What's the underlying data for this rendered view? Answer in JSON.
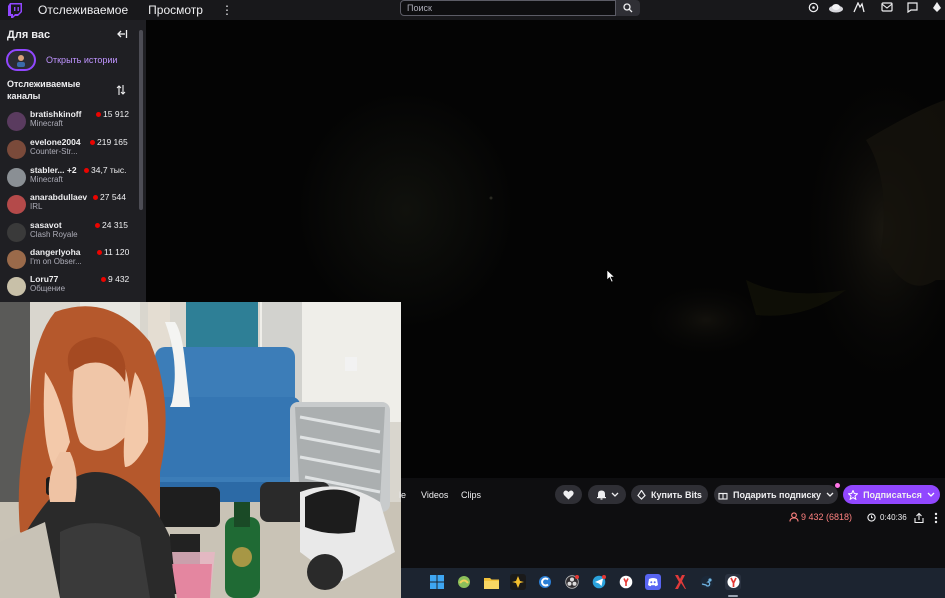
{
  "nav": {
    "following": "Отслеживаемое",
    "browse": "Просмотр",
    "more": "⋮",
    "search_placeholder": "Поиск"
  },
  "sidebar": {
    "title": "Для вас",
    "stories_label": "Открыть истории",
    "followed_title": "Отслеживаемые каналы",
    "channels": [
      {
        "name": "bratishkinoff",
        "game": "Minecraft",
        "viewers": "15 912",
        "avatar_color": "#5a3b5f"
      },
      {
        "name": "evelone2004",
        "game": "Counter-Str...",
        "viewers": "219 165",
        "avatar_color": "#7a4a3a"
      },
      {
        "name": "stabler... +2",
        "game": "Minecraft",
        "viewers": "34,7 тыс.",
        "avatar_color": "#8a8f94"
      },
      {
        "name": "anarabdullaev",
        "game": "IRL",
        "viewers": "27 544",
        "avatar_color": "#b44a4a"
      },
      {
        "name": "sasavot",
        "game": "Clash Royale",
        "viewers": "24 315",
        "avatar_color": "#3a3a3a"
      },
      {
        "name": "dangerlyoha",
        "game": "I'm on Obser...",
        "viewers": "11 120",
        "avatar_color": "#9a6a4a"
      },
      {
        "name": "Loru77",
        "game": "Общение",
        "viewers": "9 432",
        "avatar_color": "#c8c0a8"
      }
    ]
  },
  "channel_bar": {
    "tab_partial": "le",
    "tab_videos": "Videos",
    "tab_clips": "Clips",
    "buy_bits": "Купить Bits",
    "gift_sub": "Подарить подписку",
    "subscribe": "Подписаться",
    "viewers": "9 432 (6818)",
    "uptime": "0:40:36"
  },
  "colors": {
    "accent": "#9147ff",
    "live": "#eb0400",
    "viewer_count": "#ff8280"
  }
}
